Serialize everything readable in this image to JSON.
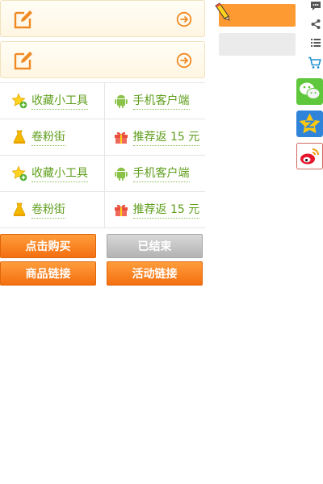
{
  "banners": [
    {
      "edit_icon": "edit-icon",
      "arrow_icon": "arrow-right-circle-icon"
    },
    {
      "edit_icon": "edit-icon",
      "arrow_icon": "arrow-right-circle-icon"
    }
  ],
  "tools": {
    "rows": [
      {
        "left": {
          "icon": "star-add-icon",
          "label": "收藏小工具"
        },
        "right": {
          "icon": "android-icon",
          "label": "手机客户端"
        }
      },
      {
        "left": {
          "icon": "dress-icon",
          "label": "卷粉街"
        },
        "right": {
          "icon": "gift-icon",
          "label": "推荐返 15 元"
        }
      },
      {
        "left": {
          "icon": "star-add-icon",
          "label": "收藏小工具"
        },
        "right": {
          "icon": "android-icon",
          "label": "手机客户端"
        }
      },
      {
        "left": {
          "icon": "dress-icon",
          "label": "卷粉街"
        },
        "right": {
          "icon": "gift-icon",
          "label": "推荐返 15 元"
        }
      }
    ]
  },
  "buttons": {
    "buy": "点击购买",
    "ended": "已结束",
    "product_link": "商品链接",
    "activity_link": "活动链接"
  },
  "colors": {
    "accent": "#fd9a32",
    "link_green": "#5f9e1c",
    "button_orange": "#f46f10",
    "button_gray": "#b3b3b3"
  },
  "sidebar": {
    "icons": [
      "comment-icon",
      "share-icon",
      "list-icon",
      "cart-icon",
      "wechat-icon",
      "qzone-icon",
      "weibo-icon"
    ]
  }
}
